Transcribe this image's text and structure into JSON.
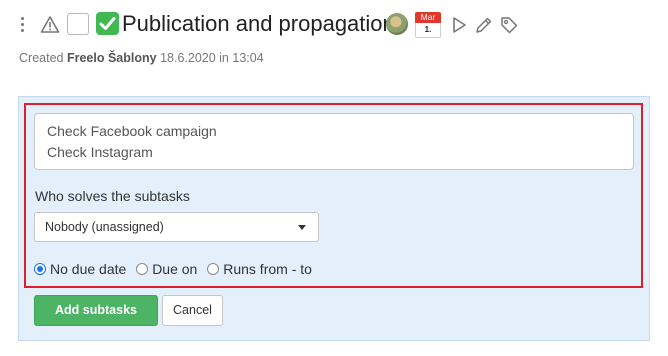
{
  "task": {
    "title": "Publication and propagation",
    "done_emoji": "check-mark-button-icon",
    "calendar": {
      "month": "Mar",
      "day": "1."
    },
    "icons": [
      "kebab-menu-icon",
      "warning-icon",
      "avatar",
      "calendar-icon",
      "play-icon",
      "pencil-icon",
      "tag-icon"
    ]
  },
  "meta": {
    "prefix": "Created",
    "author": "Freelo Šablony",
    "date": "18.6.2020",
    "in": "in",
    "time": "13:04"
  },
  "subtasks_form": {
    "lines": [
      "Check Facebook campaign",
      "Check Instagram"
    ],
    "who_label": "Who solves the subtasks",
    "assignee": "Nobody (unassigned)",
    "due_options": [
      {
        "label": "No due date",
        "selected": true
      },
      {
        "label": "Due on",
        "selected": false
      },
      {
        "label": "Runs from - to",
        "selected": false
      }
    ],
    "add_label": "Add subtasks",
    "cancel_label": "Cancel"
  },
  "colors": {
    "accent_green": "#4cb464",
    "panel_bg": "#e3f0fb",
    "highlight_red": "#e01e2d",
    "radio_blue": "#1a73e8"
  }
}
